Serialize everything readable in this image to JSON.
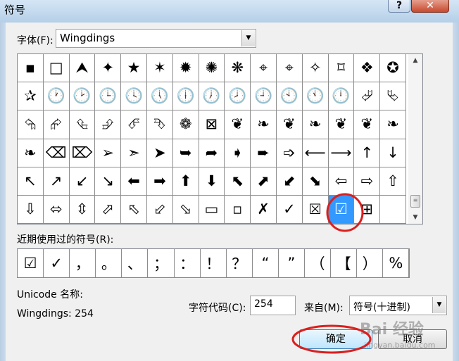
{
  "window": {
    "title": "符号",
    "help": "?",
    "close": "✕"
  },
  "font": {
    "label": "字体(F):",
    "value": "Wingdings"
  },
  "symbol_rows": [
    [
      "▪",
      "□",
      "⮝",
      "✦",
      "★",
      "✶",
      "✹",
      "✺",
      "❋",
      "⌖",
      "⌖",
      "✧",
      "⌑",
      "❖",
      "✪"
    ],
    [
      "✰",
      "🕐",
      "🕑",
      "🕒",
      "🕓",
      "🕔",
      "🕕",
      "🕖",
      "🕗",
      "🕘",
      "🕙",
      "🕚",
      "🕛",
      "⮰",
      "⮱"
    ],
    [
      "⮲",
      "⮳",
      "⮴",
      "⮵",
      "⮶",
      "⮷",
      "❁",
      "⊠",
      "❦",
      "❧",
      "❦",
      "❧",
      "❦",
      "❦",
      "❧"
    ],
    [
      "❧",
      "⌫",
      "⌦",
      "➢",
      "➣",
      "➤",
      "➥",
      "➦",
      "➧",
      "➨",
      "➩",
      "⟵",
      "⟶",
      "↑",
      "↓"
    ],
    [
      "↖",
      "↗",
      "↙",
      "↘",
      "⬅",
      "➡",
      "⬆",
      "⬇",
      "⬉",
      "⬈",
      "⬋",
      "⬊",
      "⇦",
      "⇨",
      "⇧"
    ],
    [
      "⇩",
      "⬄",
      "⇳",
      "⬀",
      "⬁",
      "⬃",
      "⬂",
      "▭",
      "▫",
      "✗",
      "✓",
      "⮽",
      "☑",
      "⊞",
      ""
    ]
  ],
  "recent": {
    "label": "近期使用过的符号(R):",
    "symbols": [
      "☑",
      "✓",
      "，",
      "。",
      "、",
      "；",
      "：",
      "！",
      "？",
      "“",
      "”",
      "（",
      "【",
      "）",
      "%"
    ]
  },
  "unicode_name_label": "Unicode 名称:",
  "wingdings_code": "Wingdings: 254",
  "char_code": {
    "label": "字符代码(C):",
    "value": "254"
  },
  "from": {
    "label": "来自(M):",
    "value": "符号(十进制)"
  },
  "buttons": {
    "ok": "确定",
    "cancel": "取消"
  },
  "watermark": {
    "text": "Bai 经验",
    "url": "jingyan.baidu.com"
  },
  "selected_symbol": "☑",
  "colors": {
    "selection": "#3399ff",
    "annotation_ring": "#d9201f"
  }
}
